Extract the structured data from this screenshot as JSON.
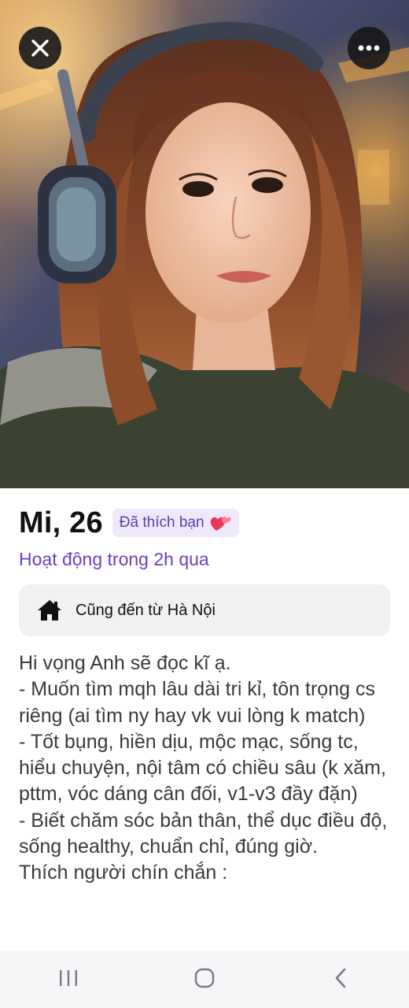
{
  "profile": {
    "name_age": "Mi, 26",
    "liked_badge": "Đã thích bạn",
    "activity": "Hoạt động trong 2h qua",
    "hometown": "Cũng đến từ Hà Nội",
    "bio": "Hi vọng Anh sẽ đọc kĩ ạ.\n- Muốn tìm mqh lâu dài tri kỉ, tôn trọng cs riêng (ai tìm ny hay vk vui lòng k match)\n- Tốt bụng, hiền dịu, mộc mạc, sống tc, hiểu chuyện, nội tâm có chiều sâu (k xăm, pttm, vóc dáng cân đối, v1-v3 đầy đặn)\n- Biết chăm sóc bản thân, thể dục điều độ, sống healthy, chuẩn chỉ, đúng giờ.\nThích người chín chắn :"
  },
  "icons": {
    "close": "close-icon",
    "more": "more-icon",
    "heart": "two-hearts-icon",
    "home": "home-icon",
    "recents": "recent-apps-icon",
    "home_nav": "home-nav-icon",
    "back": "back-icon"
  },
  "colors": {
    "accent": "#6a3fc6",
    "badge_bg": "#efe8fb",
    "badge_text": "#5a3fa6",
    "card_bg": "#f1f1f3",
    "heart": "#e8365a"
  }
}
